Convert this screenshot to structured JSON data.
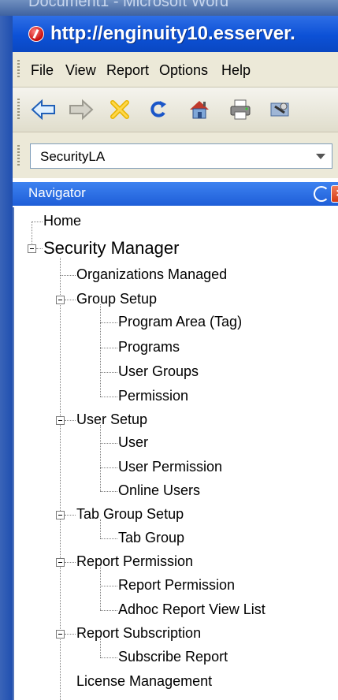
{
  "background_window_title": "Document1 - Microsoft Word",
  "window_title": "http://enginuity10.esserver.",
  "menu": [
    "File",
    "View",
    "Report",
    "Options",
    "Help"
  ],
  "toolbar_icons": [
    "back-arrow-icon",
    "forward-arrow-icon",
    "cancel-x-icon",
    "refresh-icon",
    "home-icon",
    "print-icon",
    "tools-icon"
  ],
  "combo": {
    "value": "SecurityLA"
  },
  "navigator": {
    "title": "Navigator",
    "tree": {
      "home": "Home",
      "security_manager": "Security Manager",
      "organizations_managed": "Organizations Managed",
      "group_setup": "Group Setup",
      "program_area": "Program Area (Tag)",
      "programs": "Programs",
      "user_groups": "User Groups",
      "permission": "Permission",
      "user_setup": "User Setup",
      "user": "User",
      "user_permission": "User Permission",
      "online_users": "Online Users",
      "tab_group_setup": "Tab Group Setup",
      "tab_group": "Tab Group",
      "report_permission_group": "Report Permission",
      "report_permission": "Report Permission",
      "adhoc_report_view_list": "Adhoc Report View List",
      "report_subscription": "Report Subscription",
      "subscribe_report": "Subscribe Report",
      "license_management": "License Management"
    }
  },
  "colors": {
    "titlebar": "#0c51d6",
    "navigator_header": "#3d82f0",
    "close_button": "#d63b14",
    "menubar": "#ece9d8"
  }
}
